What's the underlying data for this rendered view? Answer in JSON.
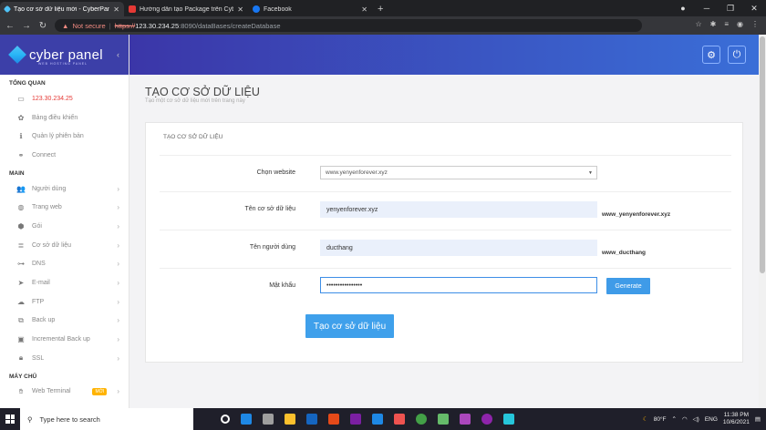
{
  "browser": {
    "tabs": [
      {
        "title": "Tạo cơ sở dữ liệu mới - CyberPan",
        "active": true,
        "icon_color": "#4fc3f7"
      },
      {
        "title": "Hướng dẫn tạo Package trên Cyb",
        "active": false,
        "icon_color": "#e53935"
      },
      {
        "title": "Facebook",
        "active": false,
        "icon_color": "#1877f2"
      }
    ],
    "security": "Not secure",
    "url_scheme": "https://",
    "url_host": "123.30.234.25",
    "url_path": ":8090/dataBases/createDatabase"
  },
  "sidebar": {
    "brand": "cyber panel",
    "tagline": "WEB HOSTING PANEL",
    "sections": [
      {
        "heading": "TỔNG QUAN",
        "items": [
          {
            "label": "123.30.234.25",
            "icon": "laptop-icon",
            "arrow": false
          },
          {
            "label": "Bảng điều khiển",
            "icon": "dashboard-icon",
            "arrow": false
          },
          {
            "label": "Quản lý phiên bản",
            "icon": "info-icon",
            "arrow": false
          },
          {
            "label": "Connect",
            "icon": "link-icon",
            "arrow": false
          }
        ]
      },
      {
        "heading": "MAIN",
        "items": [
          {
            "label": "Người dùng",
            "icon": "users-icon",
            "arrow": true
          },
          {
            "label": "Trang web",
            "icon": "globe-icon",
            "arrow": true
          },
          {
            "label": "Gói",
            "icon": "cubes-icon",
            "arrow": true
          },
          {
            "label": "Cơ sở dữ liệu",
            "icon": "database-icon",
            "arrow": true
          },
          {
            "label": "DNS",
            "icon": "sitemap-icon",
            "arrow": true
          },
          {
            "label": "E-mail",
            "icon": "paper-plane-icon",
            "arrow": true
          },
          {
            "label": "FTP",
            "icon": "cloud-upload-icon",
            "arrow": true
          },
          {
            "label": "Back up",
            "icon": "copy-icon",
            "arrow": true
          },
          {
            "label": "Incremental Back up",
            "icon": "save-icon",
            "arrow": true
          },
          {
            "label": "SSL",
            "icon": "lock-icon",
            "arrow": true
          }
        ]
      },
      {
        "heading": "MÁY CHỦ",
        "items": [
          {
            "label": "Web Terminal",
            "icon": "terminal-icon",
            "arrow": true,
            "badge": "MỚI"
          }
        ]
      }
    ]
  },
  "page": {
    "title": "TẠO CƠ SỞ DỮ LIỆU",
    "subtitle": "Tạo một cơ sở dữ liệu mới trên trang này",
    "card_title": "TẠO CƠ SỞ DỮ LIỆU",
    "website_label": "Chọn website",
    "website_value": "www.yenyenforever.xyz",
    "dbname_label": "Tên cơ sở dữ liệu",
    "dbname_value": "yenyenforever.xyz",
    "dbname_suffix": "www_yenyenforever.xyz",
    "user_label": "Tên người dùng",
    "user_value": "ducthang",
    "user_suffix": "www_ducthang",
    "password_label": "Mật khẩu",
    "password_value": "••••••••••••••••",
    "generate_label": "Generate",
    "create_label": "Tạo cơ sở dữ liệu"
  },
  "taskbar": {
    "search_placeholder": "Type here to search",
    "weather": "80°F",
    "lang": "ENG",
    "time": "11:38 PM",
    "date": "10/6/2021"
  }
}
